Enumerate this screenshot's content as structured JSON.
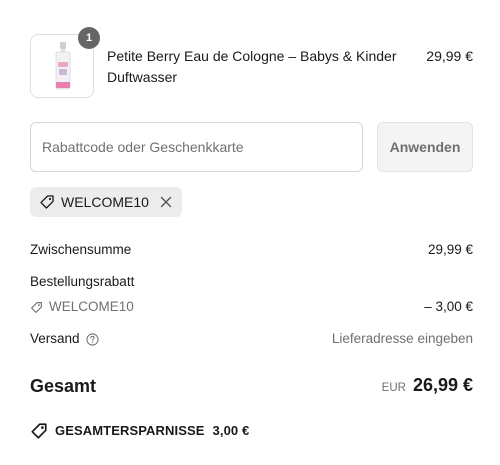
{
  "product": {
    "name": "Petite Berry Eau de Cologne – Babys & Kinder Duftwasser",
    "price": "29,99 €",
    "quantity": "1",
    "image_icon": "perfume-bottle-icon"
  },
  "discount": {
    "placeholder": "Rabattcode oder Geschenkkarte",
    "value": "",
    "apply_label": "Anwenden",
    "applied_code": "WELCOME10",
    "tag_icon": "tag-icon",
    "remove_icon": "close-icon"
  },
  "summary": {
    "subtotal_label": "Zwischensumme",
    "subtotal_value": "29,99 €",
    "order_discount_label": "Bestellungsrabatt",
    "discount_code": "WELCOME10",
    "discount_value": "– 3,00 €",
    "shipping_label": "Versand",
    "shipping_value": "Lieferadresse eingeben",
    "help_icon": "help-circle-icon",
    "total_label": "Gesamt",
    "currency": "EUR",
    "total_value": "26,99 €",
    "savings_label": "GESAMTERSPARNISSE",
    "savings_value": "3,00 €"
  },
  "colors": {
    "text": "#1a1a1a",
    "muted": "#707070",
    "badge": "#666666",
    "chip_bg": "#ececec",
    "button_bg": "#f4f4f4",
    "border": "#d5d5d5"
  }
}
